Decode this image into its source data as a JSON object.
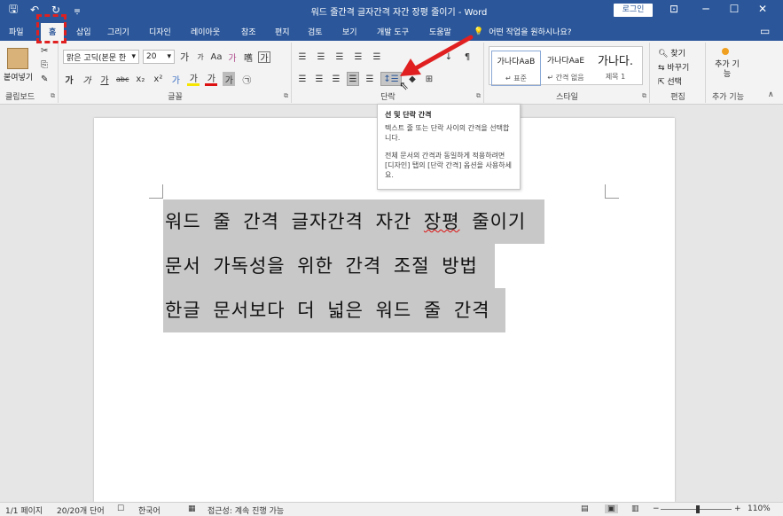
{
  "window": {
    "title": "워드 줄간격 글자간격 자간 장평 줄이기 - Word",
    "login_label": "로그인",
    "controls": [
      "⊡",
      "─",
      "☐",
      "✕"
    ]
  },
  "qat": {
    "save_icon": "🖫",
    "undo_icon": "↶",
    "redo_icon": "↻",
    "more_icon": "⩦"
  },
  "tabs": [
    {
      "label": "파일"
    },
    {
      "label": "홈"
    },
    {
      "label": "삽입"
    },
    {
      "label": "그리기"
    },
    {
      "label": "디자인"
    },
    {
      "label": "레이아웃"
    },
    {
      "label": "참조"
    },
    {
      "label": "편지"
    },
    {
      "label": "검토"
    },
    {
      "label": "보기"
    },
    {
      "label": "개발 도구"
    },
    {
      "label": "도움말"
    }
  ],
  "tell_me": {
    "icon": "💡",
    "text": "어떤 작업을 원하시나요?"
  },
  "ribbon": {
    "clipboard": {
      "label": "클립보드",
      "paste_label": "붙여넣기",
      "paste_icon": "📋"
    },
    "font": {
      "label": "글꼴",
      "font_name": "맑은 고딕(본문 한",
      "font_size": "20",
      "grow_icon": "가",
      "shrink_icon": "가",
      "case_icon": "Aa",
      "clear_icon": "가",
      "phonetic_icon": "嚿",
      "border_icon": "가",
      "bold": "가",
      "italic": "가",
      "underline": "가",
      "strike": "abc",
      "subscript": "x₂",
      "superscript": "x²",
      "effects": "가",
      "highlight": "가",
      "color": "가",
      "shade": "가",
      "circle": "㉠"
    },
    "paragraph": {
      "label": "단락",
      "bullets": "☰",
      "numbering": "☰",
      "multilevel": "☰",
      "decrease_indent": "☰",
      "increase_indent": "☰",
      "sort": "↓",
      "show_marks": "¶",
      "align_left": "☰",
      "align_center": "☰",
      "align_right": "☰",
      "justify": "☰",
      "distributed": "☰",
      "line_spacing": "↕☰",
      "shading": "◆",
      "borders": "⊞"
    },
    "styles": {
      "label": "스타일",
      "items": [
        {
          "preview": "가나다AaB",
          "name": "↵ 표준"
        },
        {
          "preview": "가나다AaE",
          "name": "↵ 간격 없음"
        },
        {
          "preview": "가나다.",
          "name": "제목 1"
        }
      ]
    },
    "editing": {
      "label": "편집",
      "find": "찾기",
      "replace": "바꾸기",
      "select": "선택"
    },
    "addins": {
      "label": "추가 기능",
      "button": "추가 기능"
    }
  },
  "tooltip": {
    "title": "선 및 단락 간격",
    "line1": "텍스트 줄 또는 단락 사이의 간격을 선택합니다.",
    "line2": "전체 문서의 간격과 동일하게 적용하려면 [디자인] 탭의 [단락 간격] 옵션을 사용하세요."
  },
  "document": {
    "lines": [
      "워드 줄 간격 글자간격 자간",
      "장평",
      "줄이기",
      "문서 가독성을 위한 간격 조절 방법",
      "한글 문서보다 더 넓은 워드 줄 간격"
    ]
  },
  "status": {
    "page": "1/1 페이지",
    "words": "20/20개 단어",
    "proof_icon": "☐",
    "language": "한국어",
    "track_icon": "▦",
    "accessibility": "접근성: 계속 진행 가능",
    "zoom": "110%",
    "view_icons": [
      "▤",
      "▣",
      "▥"
    ],
    "minus": "−",
    "plus": "+"
  },
  "colors": {
    "brand": "#2b579a",
    "highlight": "#c8c8c8",
    "arrow": "#e02020"
  }
}
